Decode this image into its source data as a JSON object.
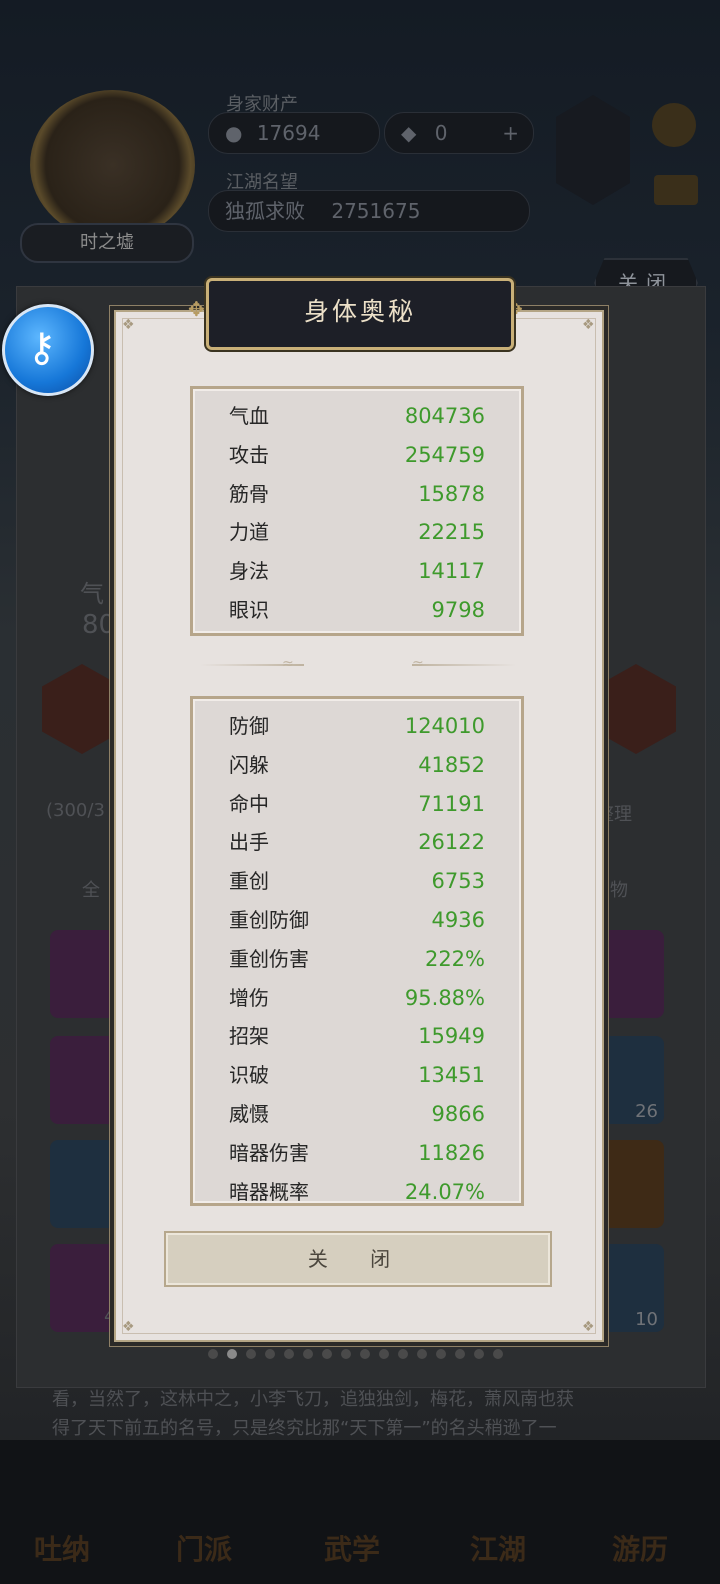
{
  "hud": {
    "avatar_name": "时之墟",
    "wealth_label": "身家财产",
    "gold": "17694",
    "gems": "0",
    "plus": "+",
    "fame_label": "江湖名望",
    "title": "独孤求败",
    "fame": "2751675"
  },
  "close_top": "关闭",
  "background": {
    "stat_peek": "气",
    "stat_peek_value": "80",
    "bag_count": "(300/3",
    "sort_button": "整理",
    "filter_left": "全",
    "filter_right": "物",
    "slot_counts": [
      "26",
      "10",
      "4"
    ],
    "story_text_1": "看，当然了，这林中之，小李飞刀，追独独剑，梅花，萧风南也获",
    "story_text_2": "得了天下前五的名号，只是终究比那“天下第一”的名头稍逊了一"
  },
  "modal": {
    "title": "身体奥秘",
    "close_button": "关 闭",
    "primary_stats": [
      {
        "name": "气血",
        "value": "804736"
      },
      {
        "name": "攻击",
        "value": "254759"
      },
      {
        "name": "筋骨",
        "value": "15878"
      },
      {
        "name": "力道",
        "value": "22215"
      },
      {
        "name": "身法",
        "value": "14117"
      },
      {
        "name": "眼识",
        "value": "9798"
      }
    ],
    "secondary_stats": [
      {
        "name": "防御",
        "value": "124010"
      },
      {
        "name": "闪躲",
        "value": "41852"
      },
      {
        "name": "命中",
        "value": "71191"
      },
      {
        "name": "出手",
        "value": "26122"
      },
      {
        "name": "重创",
        "value": "6753"
      },
      {
        "name": "重创防御",
        "value": "4936"
      },
      {
        "name": "重创伤害",
        "value": "222%"
      },
      {
        "name": "增伤",
        "value": "95.88%"
      },
      {
        "name": "招架",
        "value": "15949"
      },
      {
        "name": "识破",
        "value": "13451"
      },
      {
        "name": "威慑",
        "value": "9866"
      },
      {
        "name": "暗器伤害",
        "value": "11826"
      },
      {
        "name": "暗器概率",
        "value": "24.07%"
      }
    ]
  },
  "bottom_nav": [
    "吐纳",
    "门派",
    "武学",
    "江湖",
    "游历"
  ],
  "page_dots": {
    "total": 16,
    "active": 1
  },
  "colors": {
    "stat_value": "#3e9a2c",
    "frame_gold": "#c9b078",
    "modal_bg": "#e7e2df"
  }
}
